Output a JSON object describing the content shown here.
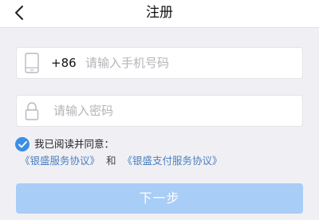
{
  "header": {
    "title": "注册",
    "back_icon": "chevron-left-icon"
  },
  "form": {
    "phone": {
      "icon": "mobile-phone-icon",
      "country_code": "+86",
      "placeholder": "请输入手机号码",
      "value": ""
    },
    "password": {
      "icon": "lock-icon",
      "placeholder": "请输入密码",
      "value": ""
    }
  },
  "agreement": {
    "checked": true,
    "prefix": "我已阅读并同意：",
    "link1": "《银盛服务协议》",
    "conjunction": "和",
    "link2": "《银盛支付服务协议》"
  },
  "actions": {
    "next_label": "下一步"
  },
  "colors": {
    "background": "#f0f0f4",
    "accent": "#3a8ee6",
    "link": "#4a7fc0",
    "button_disabled": "#a8cdf6"
  }
}
